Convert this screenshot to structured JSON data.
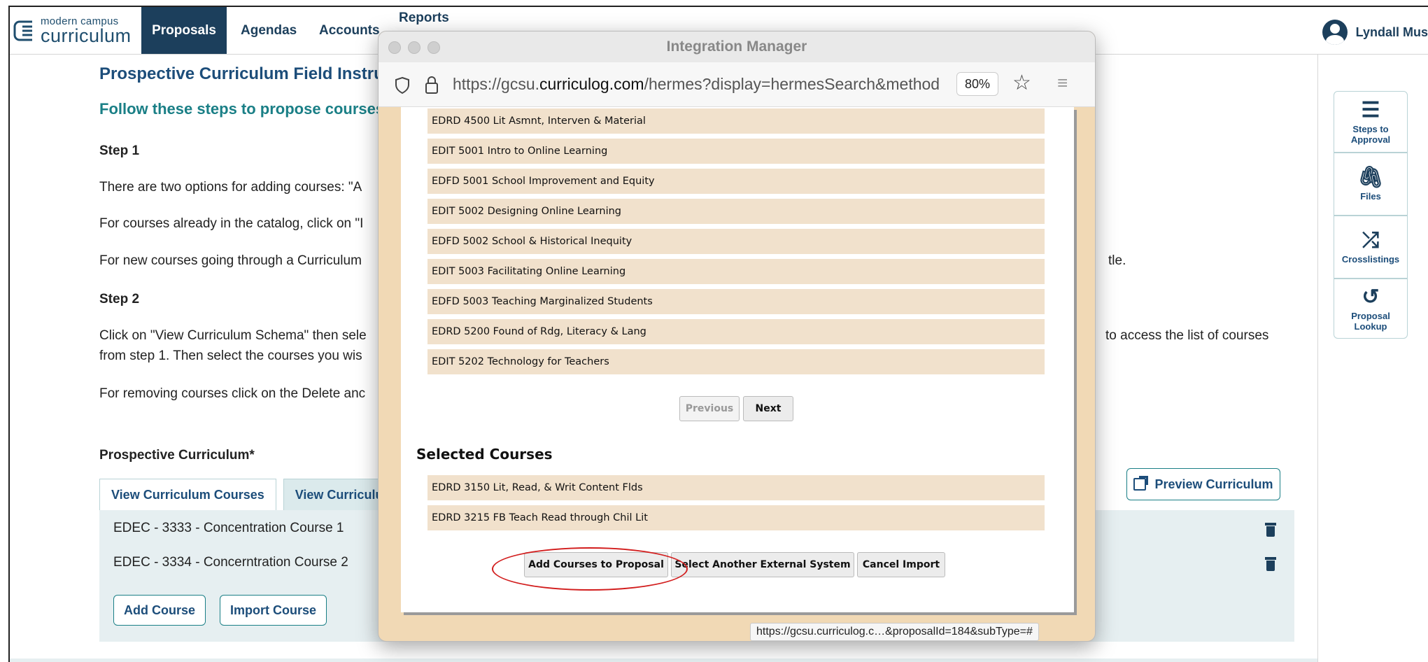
{
  "header": {
    "logo_small": "modern campus",
    "logo_big": "curriculum",
    "nav": [
      "Proposals",
      "Agendas",
      "Accounts",
      "Reports"
    ],
    "user": "Lyndall Mus"
  },
  "main": {
    "heading": "Prospective Curriculum Field Instructio",
    "sub": "Follow these steps to propose courses to",
    "step1": "Step 1",
    "p1": "There are two options for adding courses: \"A",
    "p2": "For courses already in the catalog, click on \"I",
    "p3": "For new courses going through a Curriculum",
    "p3_tail": "tle.",
    "step2": "Step 2",
    "p4": "Click on \"View Curriculum Schema\" then sele",
    "p4_tail": "to access the list of courses",
    "p5": "from step 1. Then select the courses you wis",
    "p6": "For removing courses click on the Delete anc",
    "pc_label": "Prospective Curriculum*",
    "tabs": [
      "View Curriculum Courses",
      "View Curriculum S"
    ],
    "courses": [
      "EDEC - 3333 - Concentration Course 1",
      "EDEC - 3334 - Concerntration Course 2"
    ],
    "add_course": "Add Course",
    "import_course": "Import Course",
    "preview": "Preview Curriculum"
  },
  "sidebar": [
    {
      "label": "Steps to Approval",
      "icon": "list-icon"
    },
    {
      "label": "Files",
      "icon": "paperclip-icon"
    },
    {
      "label": "Crosslistings",
      "icon": "shuffle-icon"
    },
    {
      "label": "Proposal Lookup",
      "icon": "history-icon"
    }
  ],
  "modal": {
    "title": "Integration Manager",
    "url_prefix": "https://gcsu.",
    "url_domain": "curriculog.com",
    "url_rest": "/hermes?display=hermesSearch&method",
    "zoom": "80%",
    "courses": [
      "EDRD 4500 Lit Asmnt, Interven & Material",
      "EDIT 5001 Intro to Online Learning",
      "EDFD 5001 School Improvement and Equity",
      "EDIT 5002 Designing Online Learning",
      "EDFD 5002 School & Historical Inequity",
      "EDIT 5003 Facilitating Online Learning",
      "EDFD 5003 Teaching Marginalized Students",
      "EDRD 5200 Found of Rdg, Literacy & Lang",
      "EDIT 5202 Technology for Teachers"
    ],
    "previous": "Previous",
    "next": "Next",
    "selected_title": "Selected Courses",
    "selected": [
      "EDRD 3150 Lit, Read, & Writ Content Flds",
      "EDRD 3215 FB Teach Read through Chil Lit"
    ],
    "add_to_proposal": "Add Courses to Proposal",
    "select_another": "Select Another External System",
    "cancel": "Cancel Import",
    "status_url": "https://gcsu.curriculog.c…&proposalId=184&subType=#"
  },
  "colors": {
    "brand": "#1c3f5c",
    "teal": "#1a7f86",
    "highlight": "#d21d1d"
  }
}
